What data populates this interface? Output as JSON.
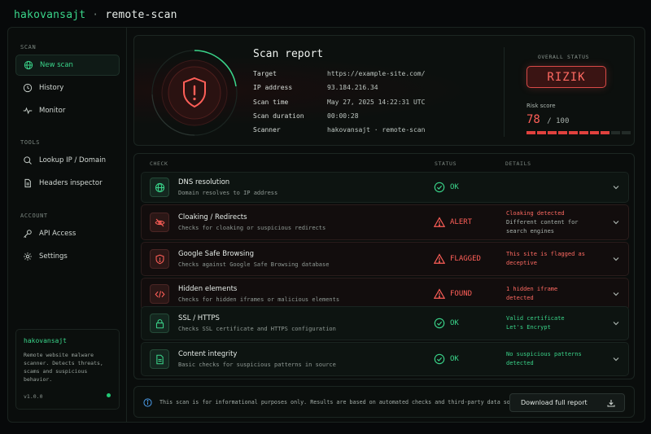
{
  "header": {
    "brand": "hakovansajt",
    "separator": "·",
    "title": "remote-scan"
  },
  "sidebar": {
    "sections": [
      {
        "label": "SCAN",
        "items": [
          {
            "label": "New scan",
            "icon": "globe-icon",
            "active": true
          },
          {
            "label": "History",
            "icon": "clock-icon"
          },
          {
            "label": "Monitor",
            "icon": "pulse-icon"
          }
        ]
      },
      {
        "label": "TOOLS",
        "items": [
          {
            "label": "Lookup IP / Domain",
            "icon": "search-icon"
          },
          {
            "label": "Headers inspector",
            "icon": "document-icon"
          }
        ]
      },
      {
        "label": "ACCOUNT",
        "items": [
          {
            "label": "API Access",
            "icon": "key-icon"
          },
          {
            "label": "Settings",
            "icon": "gear-icon"
          }
        ]
      }
    ],
    "about": {
      "name": "hakovansajt",
      "description": "Remote website malware scanner. Detects threats, scams and suspicious behavior.",
      "version": "v1.0.0"
    }
  },
  "report": {
    "title": "Scan report",
    "fields": [
      {
        "key": "Target",
        "value": "https://example-site.com/"
      },
      {
        "key": "IP address",
        "value": "93.184.216.34"
      },
      {
        "key": "Scan time",
        "value": "May 27, 2025 14:22:31 UTC"
      },
      {
        "key": "Scan duration",
        "value": "00:00:28"
      },
      {
        "key": "Scanner",
        "value": "hakovansajt · remote-scan"
      }
    ],
    "overall_status_label": "OVERALL STATUS",
    "overall_status": "RIZIK",
    "risk_label": "Risk score",
    "risk_score": "78",
    "risk_max": "/ 100",
    "risk_fraction": 0.78
  },
  "checks": {
    "headers": {
      "check": "CHECK",
      "status": "STATUS",
      "details": "DETAILS"
    },
    "rows": [
      {
        "name": "DNS resolution",
        "sub": "Domain resolves to IP address",
        "status": "OK",
        "level": "ok",
        "icon": "globe-icon",
        "details": []
      },
      {
        "name": "Cloaking / Redirects",
        "sub": "Checks for cloaking or suspicious redirects",
        "status": "ALERT",
        "level": "bad",
        "icon": "eye-off-icon",
        "details": [
          "Cloaking detected",
          "Different content for",
          "search engines"
        ]
      },
      {
        "name": "Google Safe Browsing",
        "sub": "Checks against Google Safe Browsing database",
        "status": "FLAGGED",
        "level": "bad",
        "icon": "shield-alert-icon",
        "details": [
          "This site is flagged as",
          "deceptive"
        ]
      },
      {
        "name": "Hidden elements",
        "sub": "Checks for hidden iframes or malicious elements",
        "status": "FOUND",
        "level": "bad",
        "icon": "code-icon",
        "details": [
          "1 hidden iframe",
          "detected"
        ]
      },
      {
        "name": "SSL / HTTPS",
        "sub": "Checks SSL certificate and HTTPS configuration",
        "status": "OK",
        "level": "ok",
        "icon": "lock-icon",
        "details": [
          "Valid certificate",
          "Let's Encrypt"
        ]
      },
      {
        "name": "Content integrity",
        "sub": "Basic checks for suspicious patterns in source",
        "status": "OK",
        "level": "ok",
        "icon": "file-text-icon",
        "details": [
          "No suspicious patterns",
          "detected"
        ]
      }
    ]
  },
  "footer": {
    "note": "This scan is for informational purposes only. Results are based on automated checks and third-party data sources.",
    "download_label": "Download full report"
  },
  "colors": {
    "accent": "#3ad58a",
    "danger": "#ff5f58",
    "background": "#07090a"
  }
}
